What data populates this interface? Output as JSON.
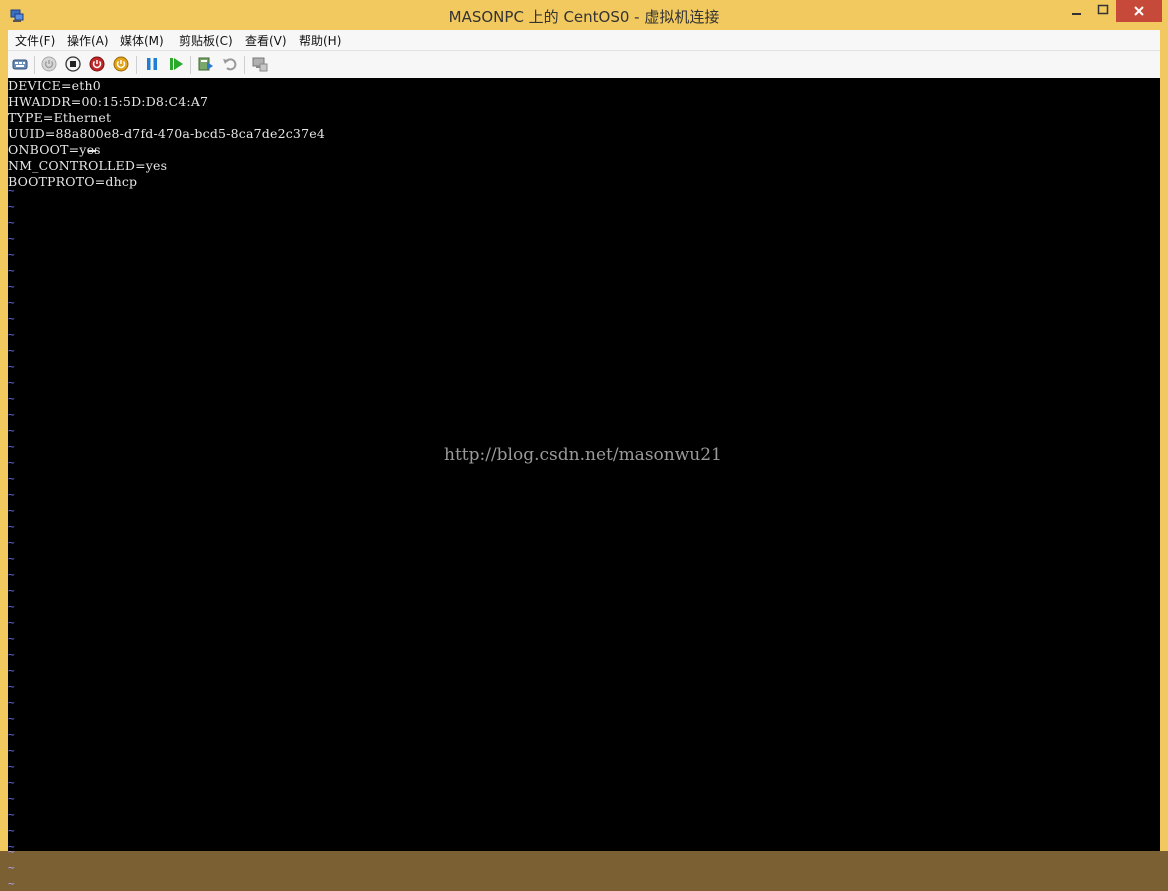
{
  "window": {
    "title": "MASONPC 上的 CentOS0 - 虚拟机连接",
    "minimize_label": "—",
    "maximize_label": "□",
    "close_label": "✕"
  },
  "menu": [
    {
      "label": "文件(F)"
    },
    {
      "label": "操作(A)"
    },
    {
      "label": "媒体(M)"
    },
    {
      "label": "剪贴板(C)"
    },
    {
      "label": "查看(V)"
    },
    {
      "label": "帮助(H)"
    }
  ],
  "toolbar": {
    "icons": [
      "ctrl-alt-del-icon",
      "start-icon",
      "turn-off-icon",
      "shutdown-icon",
      "save-icon",
      "pause-icon",
      "resume-icon",
      "checkpoint-icon",
      "revert-icon",
      "enhanced-session-icon"
    ]
  },
  "terminal": {
    "lines": [
      "DEVICE=eth0",
      "HWADDR=00:15:5D:D8:C4:A7",
      "TYPE=Ethernet",
      "UUID=88a800e8-d7fd-470a-bcd5-8ca7de2c37e4",
      "ONBOOT=yes",
      "NM_CONTROLLED=yes",
      "BOOTPROTO=dhcp"
    ],
    "tilde": "~"
  },
  "watermark": "http://blog.csdn.net/masonwu21",
  "colors": {
    "frame": "#f2c95f",
    "terminal_bg": "#000000",
    "terminal_text": "#e6e6e6",
    "tilde": "#6a6aff"
  }
}
